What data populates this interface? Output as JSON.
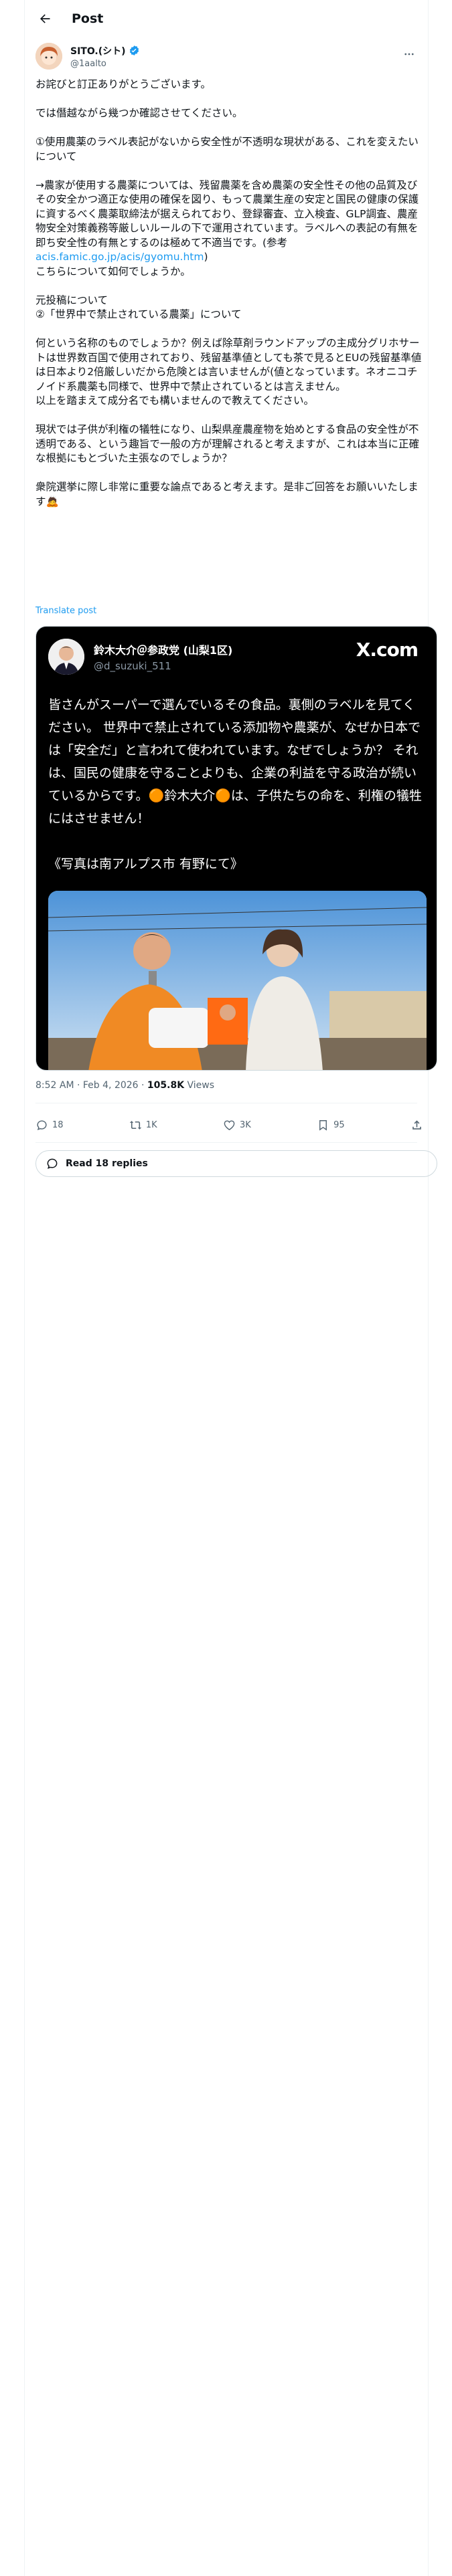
{
  "header": {
    "title": "Post",
    "back_icon": "arrow-left-icon"
  },
  "author": {
    "name": "SITO.(シト)",
    "handle": "@1aalto",
    "verified": true,
    "more_icon": "more-horizontal-icon"
  },
  "tweet": {
    "p1": "お詫びと訂正ありがとうございます。",
    "p2": "では僭越ながら幾つか確認させてください。",
    "p3": "①使用農薬のラベル表記がないから安全性が不透明な現状がある、これを変えたい について",
    "p4": "→農家が使用する農薬については、残留農薬を含め農薬の安全性その他の品質及びその安全かつ適正な使用の確保を図り、もって農業生産の安定と国民の健康の保護に資するべく農薬取締法が据えられており、登録審査、立入検査、GLP調査、農産物安全対策義務等厳しいルールの下で運用されています。ラベルへの表記の有無を即ち安全性の有無とするのは極めて不適当です。(参考 ",
    "p4_link": "acis.famic.go.jp/acis/gyomu.htm",
    "p4_end": ")\nこちらについて如何でしょうか。",
    "p5": "元投稿について\n②「世界中で禁止されている農薬」について",
    "p6": "何という名称のものでしょうか？例えば除草剤ラウンドアップの主成分グリホサートは世界数百国で使用されており、残留基準値としても茶で見るとEUの残留基準値は日本より2倍厳しいだから危険とは言いませんが(値となっています。ネオニコチノイド系農薬も同様で、世界中で禁止されているとは言えません。\n以上を踏まえて成分名でも構いませんので教えてください。",
    "p7": "現状では子供が利権の犠牲になり、山梨県産農産物を始めとする食品の安全性が不透明である、という趣旨で一般の方が理解されると考えますが、これは本当に正確な根拠にもとづいた主張なのでしょうか？",
    "p8": "衆院選挙に際し非常に重要な論点であると考えます。是非ご回答をお願いいたします🙇",
    "translate": "Translate post"
  },
  "quote": {
    "name": "鈴木大介＠参政党 (山梨1区)",
    "handle": "@d_suzuki_511",
    "logo": "X.com",
    "body": "皆さんがスーパーで選んでいるその食品。裏側のラベルを見てください。 世界中で禁止されている添加物や農薬が、なぜか日本では「安全だ」と言われて使われています。なぜでしょうか？ それは、国民の健康を守ることよりも、企業の利益を守る政治が続いているからです。🟠鈴木大介🟠は、子供たちの命を、利権の犠牲にはさせません！\n\n《写真は南アルプス市 有野にて》"
  },
  "meta": {
    "time": "8:52 AM · Feb 4, 2026 · ",
    "views_count": "105.8K",
    "views_label": " Views"
  },
  "actions": {
    "replies": "18",
    "reposts": "1K",
    "likes": "3K",
    "bookmarks": "95"
  },
  "read_replies": "Read 18 replies",
  "colors": {
    "accent": "#1d9bf0",
    "text": "#0f1419",
    "muted": "#536471"
  }
}
